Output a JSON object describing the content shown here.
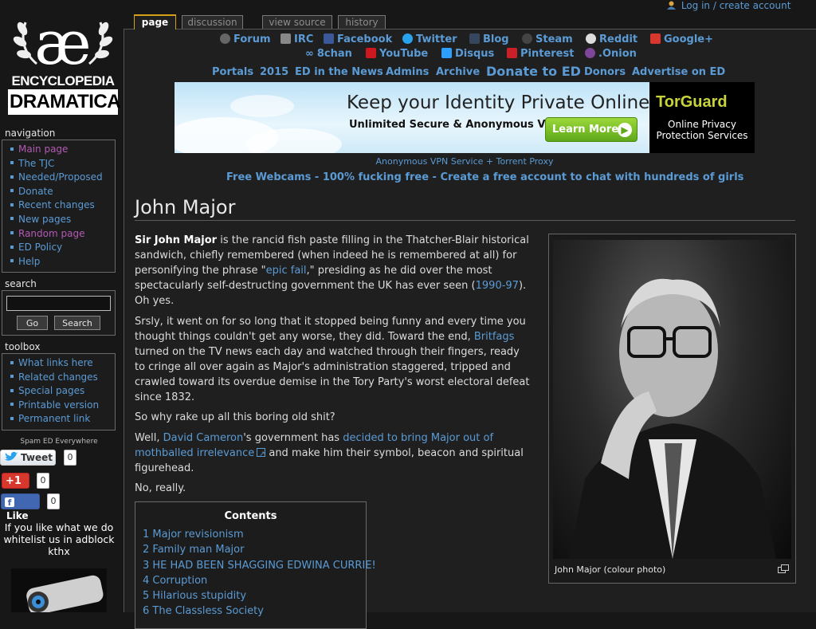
{
  "user": {
    "login_label": "Log in / create account"
  },
  "tabs": [
    {
      "label": "page",
      "active": true
    },
    {
      "label": "discussion",
      "active": false
    },
    {
      "label": "view source",
      "active": false
    },
    {
      "label": "history",
      "active": false
    }
  ],
  "logo": {
    "line1": "ENCYCLOPEDIA",
    "line2": "DRAMATICA",
    "glyph": "æ"
  },
  "navigation": {
    "heading": "navigation",
    "items": [
      "Main page",
      "The TJC",
      "Needed/Proposed",
      "Donate",
      "Recent changes",
      "New pages",
      "Random page",
      "ED Policy",
      "Help"
    ]
  },
  "search": {
    "heading": "search",
    "go_label": "Go",
    "search_label": "Search",
    "value": ""
  },
  "toolbox": {
    "heading": "toolbox",
    "items": [
      "What links here",
      "Related changes",
      "Special pages",
      "Printable version",
      "Permanent link"
    ]
  },
  "social": {
    "heading": "Spam ED Everywhere",
    "tweet_label": "Tweet",
    "tweet_count": "0",
    "gplus_label": "+1",
    "gplus_count": "0",
    "like_label": "Like",
    "like_count": "0"
  },
  "adblock_note": "If you like what we do whitelist us in adblock kthx",
  "top_links": {
    "row1": [
      "Forum",
      "IRC",
      "Facebook",
      "Twitter",
      "Blog",
      "Steam",
      "Reddit",
      "Google+"
    ],
    "row2": [
      "8chan",
      "YouTube",
      "Disqus",
      "Pinterest",
      ".Onion"
    ],
    "portals": [
      "Portals",
      "2015",
      "ED in the News",
      "Admins",
      "Archive",
      "Donate to ED",
      "Donors",
      "Advertise on ED"
    ]
  },
  "ad": {
    "headline": "Keep your Identity Private Online",
    "subline": "Unlimited Secure & Anonymous VPN",
    "button": "Learn More",
    "brand": "TorGuard",
    "brand_line1": "Online Privacy",
    "brand_line2": "Protection Services",
    "caption": "Anonymous VPN Service + Torrent Proxy",
    "webcams": "Free Webcams - 100% fucking free - Create a free account to chat with hundreds of girls"
  },
  "article": {
    "title": "John Major",
    "p1": {
      "bold": "Sir John Major",
      "t1": " is the rancid fish paste filling in the Thatcher-Blair historical sandwich, chiefly remembered (when indeed he is remembered at all) for personifying the phrase \"",
      "link1": "epic fail",
      "t2": ",\" presiding as he did over the most spectacularly self-destructing government the UK has ever seen (",
      "link2": "1990-97",
      "t3": "). Oh yes."
    },
    "p2": {
      "t1": "Srsly, it went on for so long that it stopped being funny and every time you thought things couldn't get any worse, they did. Toward the end, ",
      "link1": "Britfags",
      "t2": " turned on the TV news each day and watched through their fingers, ready to cringe all over again as Major's administration staggered, tripped and crawled toward its overdue demise in the Tory Party's worst electoral defeat since 1832."
    },
    "p3": "So why rake up all this boring old shit?",
    "p4": {
      "t1": "Well, ",
      "link1": "David Cameron",
      "t2": "'s government has ",
      "link2": "decided to bring Major out of mothballed irrelevance",
      "t3": " and make him their symbol, beacon and spiritual figurehead."
    },
    "p5": "No, really.",
    "image_caption": "John Major (colour photo)"
  },
  "toc": {
    "title": "Contents",
    "items": [
      "1 Major revisionism",
      "2 Family man Major",
      "3 HE HAD BEEN SHAGGING EDWINA CURRIE!",
      "4 Corruption",
      "5 Hilarious stupidity",
      "6 The Classless Society"
    ]
  },
  "colors": {
    "link": "#5b9bd5",
    "visited": "#b45ab4",
    "background": "#171717",
    "tab_accent": "#d4a017"
  }
}
